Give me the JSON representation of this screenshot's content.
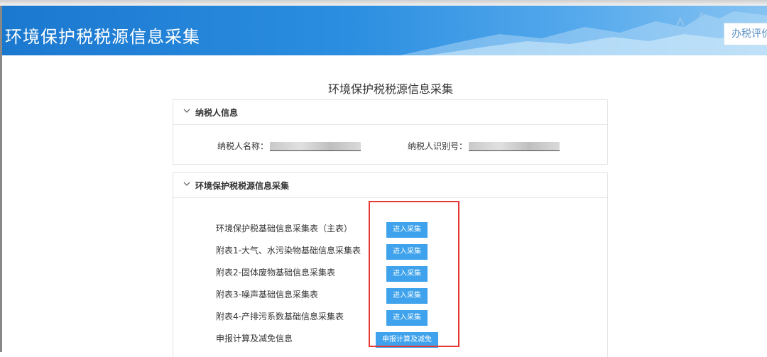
{
  "header": {
    "title": "环境保护税税源信息采集",
    "right_link": "办税评价"
  },
  "page_heading": "环境保护税税源信息采集",
  "taxpayer_panel": {
    "title": "纳税人信息",
    "name_label": "纳税人名称：",
    "id_label": "纳税人识别号："
  },
  "collection_panel": {
    "title": "环境保护税税源信息采集",
    "items": [
      {
        "label": "环境保护税基础信息采集表（主表）",
        "button": "进入采集"
      },
      {
        "label": "附表1-大气、水污染物基础信息采集表",
        "button": "进入采集"
      },
      {
        "label": "附表2-固体废物基础信息采集表",
        "button": "进入采集"
      },
      {
        "label": "附表3-噪声基础信息采集表",
        "button": "进入采集"
      },
      {
        "label": "附表4-产排污系数基础信息采集表",
        "button": "进入采集"
      },
      {
        "label": "申报计算及减免信息",
        "button": "申报计算及减免"
      }
    ]
  },
  "colors": {
    "banner": "#2b8ee0",
    "button": "#3ea2ec",
    "highlight": "#e53935"
  }
}
